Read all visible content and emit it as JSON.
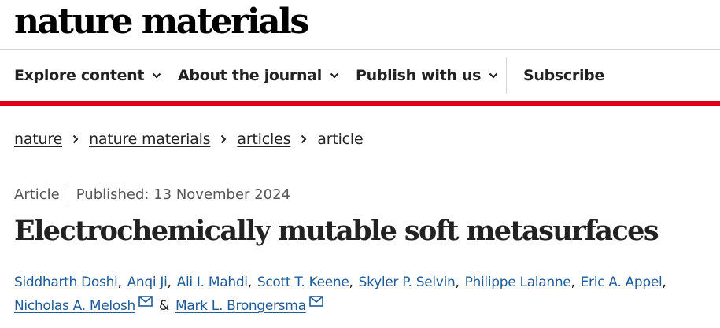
{
  "header": {
    "logo_text": "nature materials"
  },
  "nav": {
    "items": [
      {
        "label": "Explore content",
        "has_dropdown": true
      },
      {
        "label": "About the journal",
        "has_dropdown": true
      },
      {
        "label": "Publish with us",
        "has_dropdown": true
      },
      {
        "label": "Subscribe",
        "has_dropdown": false
      }
    ]
  },
  "breadcrumb": {
    "items": [
      "nature",
      "nature materials",
      "articles"
    ],
    "current": "article"
  },
  "article": {
    "type": "Article",
    "published": "Published: 13 November 2024",
    "title": "Electrochemically mutable soft metasurfaces",
    "authors_line1": [
      "Siddharth Doshi",
      "Anqi Ji",
      "Ali I. Mahdi",
      "Scott T. Keene",
      "Skyler P. Selvin",
      "Philippe Lalanne",
      "Eric A. Appel"
    ],
    "authors_line2": [
      {
        "name": "Nicholas A. Melosh",
        "corresponding": true
      },
      {
        "name": "Mark L. Brongersma",
        "corresponding": true
      }
    ],
    "separator": "&"
  },
  "colors": {
    "accent_red": "#e0001b",
    "link_blue": "#1e5b98",
    "text": "#222222"
  },
  "icons": [
    "chevron-down-icon",
    "chevron-right-icon",
    "envelope-icon"
  ]
}
